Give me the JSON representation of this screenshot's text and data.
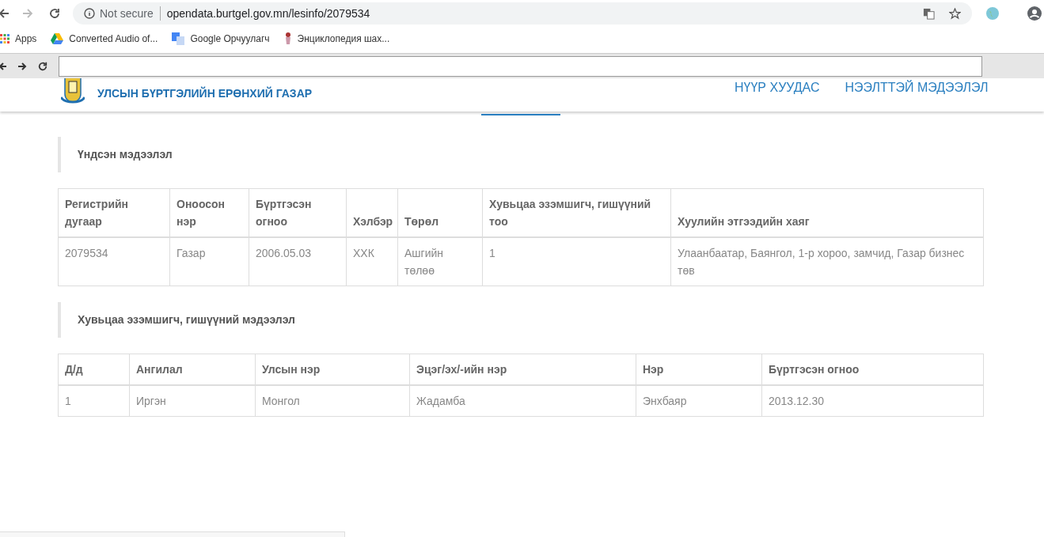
{
  "browser": {
    "security": "Not secure",
    "url": "opendata.burtgel.gov.mn/lesinfo/2079534",
    "bookmarks": [
      {
        "label": "Apps",
        "kind": "apps"
      },
      {
        "label": "Converted Audio of...",
        "kind": "drive"
      },
      {
        "label": "Google Орчуулагч",
        "kind": "translate"
      },
      {
        "label": "Энциклопедия шах...",
        "kind": "chess"
      }
    ]
  },
  "site": {
    "title": "УЛСЫН БҮРТГЭЛИЙН ЕРӨНХИЙ ГАЗАР",
    "nav": [
      {
        "label": "НҮҮР ХУУДАС"
      },
      {
        "label": "НЭЭЛТТЭЙ МЭДЭЭЛЭЛ"
      }
    ]
  },
  "sections": [
    {
      "heading": "Үндсэн мэдээлэл",
      "table": {
        "columns": [
          "Регистрийн дугаар",
          "Оноосон нэр",
          "Бүртгэсэн огноо",
          "Хэлбэр",
          "Төрөл",
          "Хувьцаа эзэмшигч, гишүүний тоо",
          "Хуулийн этгээдийн хаяг"
        ],
        "rows": [
          [
            "2079534",
            "Газар",
            "2006.05.03",
            "ХХК",
            "Ашгийн төлөө",
            "1",
            "Улаанбаатар, Баянгол, 1-р хороо, замчид, Газар бизнес төв"
          ]
        ]
      }
    },
    {
      "heading": "Хувьцаа эзэмшигч, гишүүний мэдээлэл",
      "table": {
        "columns": [
          "Д/д",
          "Ангилал",
          "Улсын нэр",
          "Эцэг/эх/-ийн нэр",
          "Нэр",
          "Бүртгэсэн огноо"
        ],
        "rows": [
          [
            "1",
            "Иргэн",
            "Монгол",
            "Жадамба",
            "Энхбаяр",
            "2013.12.30"
          ]
        ]
      }
    }
  ]
}
